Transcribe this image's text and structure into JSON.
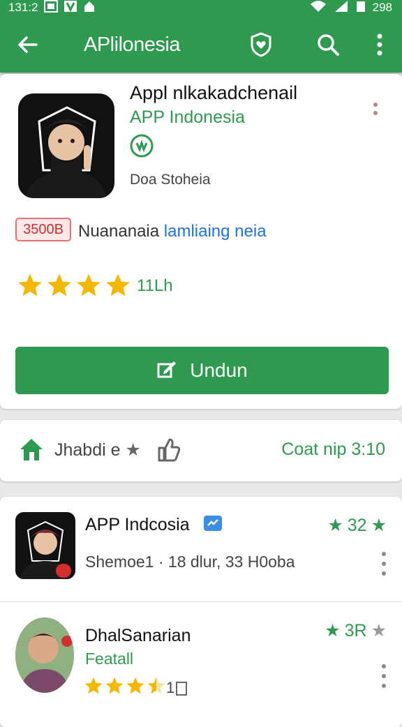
{
  "status_bar": {
    "time": "131:2",
    "battery": "298",
    "icons": [
      "gallery-icon",
      "v-icon",
      "home-icon",
      "wifi-icon",
      "signal-icon",
      "battery-icon"
    ]
  },
  "app_bar": {
    "title": "APlilonesia",
    "icons": [
      "back-arrow-icon",
      "shield-heart-icon",
      "search-icon",
      "more-vert-icon"
    ]
  },
  "app_detail": {
    "name": "Appl nlkakadchenail",
    "developer": "APP Indonesia",
    "category": "Doa Stoheia",
    "price_tag": "3500B",
    "price_text": "Nuananaia",
    "price_highlight": "lamliaing neia",
    "rating_value": 4.5,
    "rating_count": "11Lh",
    "install_label": "Undun"
  },
  "action_bar": {
    "left_label": "Jhabdi e",
    "right_label": "Coat nip 3:10"
  },
  "list": [
    {
      "title": "APP Indcosia",
      "meta": "Shemoe1 · 18 dlur, 33 H0oba",
      "rating": "32"
    },
    {
      "title": "DhalSanarian",
      "subtitle": "Featall",
      "rating": "3R",
      "rating_value": 3.5,
      "count": "1"
    }
  ],
  "colors": {
    "primary": "#2e9a4f",
    "accent_blue": "#1a73e8",
    "star": "#f5b800",
    "danger": "#d32f2f"
  }
}
